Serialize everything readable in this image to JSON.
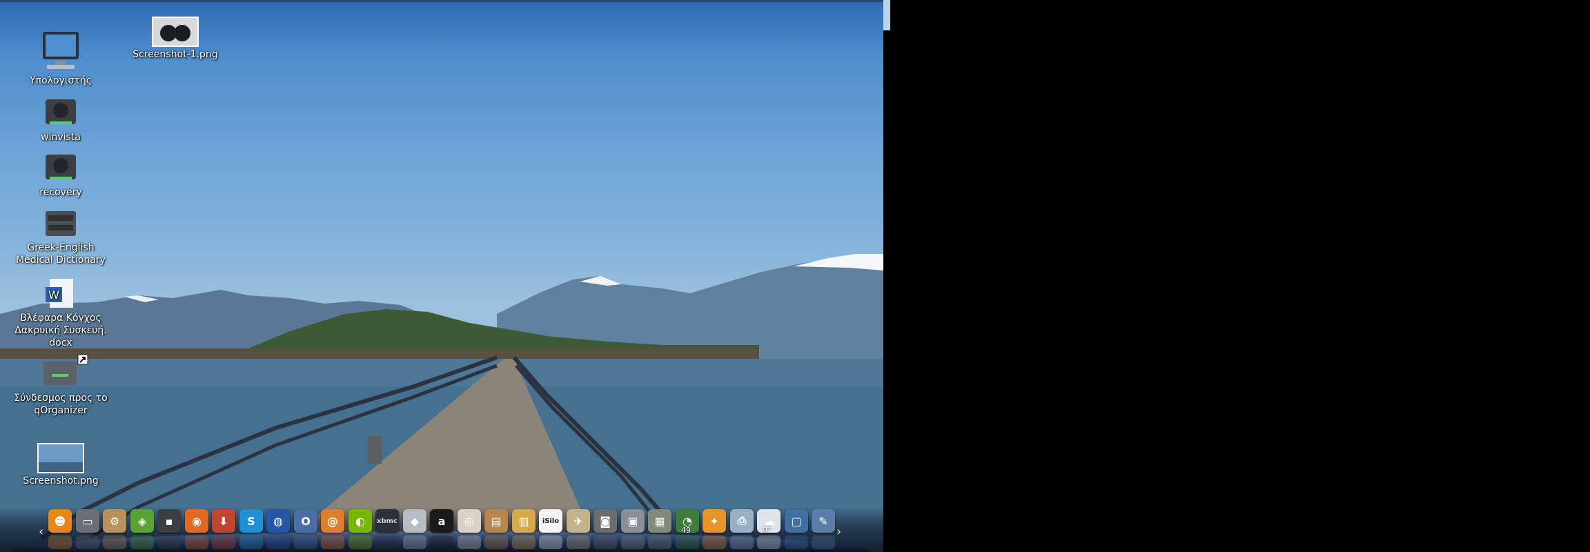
{
  "desktop_icons": [
    {
      "name": "computer",
      "label": "Υπολογιστής",
      "icon": "computer-monitor-icon"
    },
    {
      "name": "winvista",
      "label": "winvista",
      "icon": "hard-drive-icon"
    },
    {
      "name": "recovery",
      "label": "recovery",
      "icon": "hard-drive-icon"
    },
    {
      "name": "dictionary",
      "label": "Greek-English\nMedical Dictionary",
      "icon": "drive-cabinet-icon"
    },
    {
      "name": "docx",
      "label": "Βλέφαρα Κόγχος\nΔακρυική Συσκευή.\ndocx",
      "icon": "word-document-icon"
    },
    {
      "name": "qorganizer",
      "label": "Σύνδεσμος προς το\nqOrganizer",
      "icon": "shortcut-device-icon"
    },
    {
      "name": "screenshot",
      "label": "Screenshot.png",
      "icon": "image-thumbnail-icon"
    },
    {
      "name": "screenshot-1",
      "label": "Screenshot-1.png",
      "icon": "image-thumbnail-icon"
    }
  ],
  "dock": {
    "left_arrow": "‹",
    "right_arrow": "›",
    "items": [
      {
        "name": "gnome-foot",
        "glyph": "☻",
        "color": "#e8851a"
      },
      {
        "name": "file-manager",
        "glyph": "▭",
        "color": "#6b6e73"
      },
      {
        "name": "installer",
        "glyph": "⚙",
        "color": "#b9915a"
      },
      {
        "name": "maps-app",
        "glyph": "◈",
        "color": "#59a331"
      },
      {
        "name": "terminal",
        "glyph": "▪",
        "color": "#3b3f44"
      },
      {
        "name": "firefox",
        "glyph": "◉",
        "color": "#e26a20"
      },
      {
        "name": "synaptic",
        "glyph": "⬇",
        "color": "#c0442e"
      },
      {
        "name": "skype",
        "glyph": "S",
        "color": "#1f8fd6"
      },
      {
        "name": "google-earth",
        "glyph": "◍",
        "color": "#2556a8"
      },
      {
        "name": "opera",
        "glyph": "O",
        "color": "#4a6fa8"
      },
      {
        "name": "spiral-app",
        "glyph": "@",
        "color": "#e07d28"
      },
      {
        "name": "nvidia",
        "glyph": "◐",
        "color": "#76b900"
      },
      {
        "name": "xbmc",
        "glyph": "xbmc",
        "color": "#2b2f3a"
      },
      {
        "name": "diamond-app",
        "glyph": "◆",
        "color": "#b6bcc4"
      },
      {
        "name": "amarok",
        "glyph": "a",
        "color": "#1b1b1b"
      },
      {
        "name": "speaker",
        "glyph": "◎",
        "color": "#d8d3c4"
      },
      {
        "name": "archive",
        "glyph": "▤",
        "color": "#b8864a"
      },
      {
        "name": "books",
        "glyph": "▥",
        "color": "#d6a848"
      },
      {
        "name": "isilo",
        "glyph": "iSilo",
        "color": "#f4f4f4"
      },
      {
        "name": "wings",
        "glyph": "✈",
        "color": "#c4b288"
      },
      {
        "name": "camera",
        "glyph": "◙",
        "color": "#6d6d6d"
      },
      {
        "name": "screenshot-tool",
        "glyph": "▣",
        "color": "#8b8f96"
      },
      {
        "name": "system-monitor",
        "glyph": "▦",
        "color": "#7f8c79"
      },
      {
        "name": "weather",
        "glyph": "◔",
        "color": "#3f7d3b",
        "badge": "49"
      },
      {
        "name": "compass",
        "glyph": "✦",
        "color": "#e7942a"
      },
      {
        "name": "printer-app",
        "glyph": "⎙",
        "color": "#9ab0c6"
      },
      {
        "name": "cloud-weather",
        "glyph": "☁",
        "color": "#dfe4ea",
        "badge": "9°"
      },
      {
        "name": "display-settings",
        "glyph": "▢",
        "color": "#3f6fa5"
      },
      {
        "name": "pen-tool",
        "glyph": "✎",
        "color": "#5a7ea8"
      }
    ]
  }
}
